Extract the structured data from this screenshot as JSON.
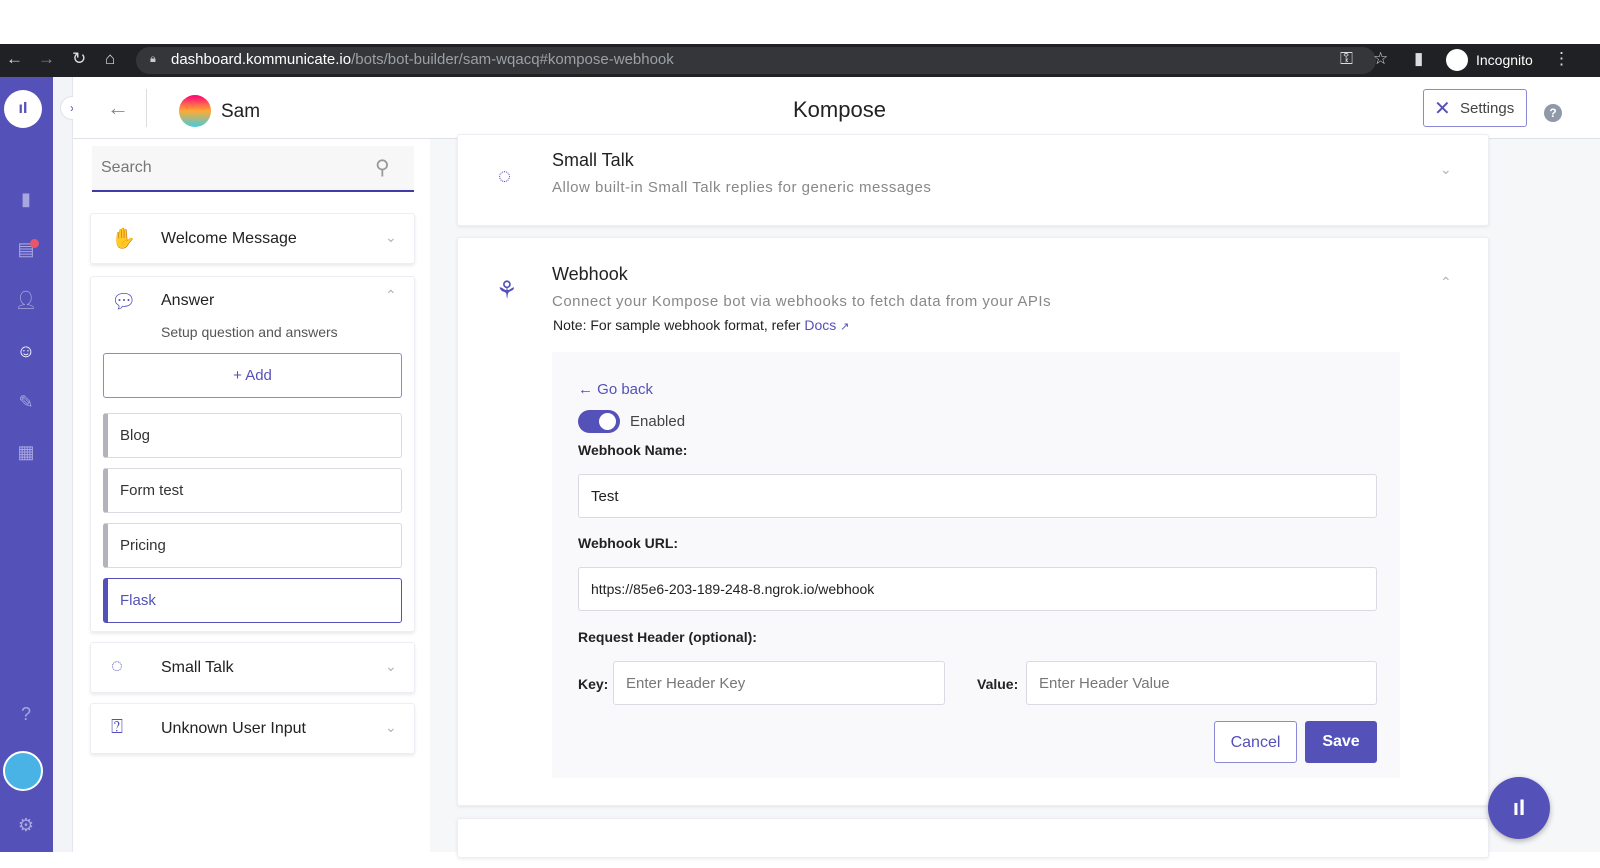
{
  "browser": {
    "url_domain": "dashboard.kommunicate.io",
    "url_path": "/bots/bot-builder/sam-wqacq#kompose-webhook",
    "profile": "Incognito"
  },
  "header": {
    "bot_name": "Sam",
    "title": "Kompose",
    "settings_label": "Settings"
  },
  "sidebar": {
    "search_placeholder": "Search",
    "sections": [
      {
        "label": "Welcome Message"
      },
      {
        "label": "Answer",
        "description": "Setup question and answers",
        "add_label": "+ Add"
      },
      {
        "label": "Small Talk"
      },
      {
        "label": "Unknown User Input"
      }
    ],
    "answers": [
      "Blog",
      "Form test",
      "Pricing",
      "Flask"
    ]
  },
  "small_talk": {
    "title": "Small Talk",
    "description": "Allow built-in Small Talk replies for generic messages"
  },
  "webhook": {
    "title": "Webhook",
    "description": "Connect your Kompose bot via webhooks to fetch data from your APIs",
    "note": "Note: For sample webhook format, refer",
    "docs_link": "Docs",
    "go_back": "← Go back",
    "enabled_label": "Enabled",
    "enabled": true,
    "name_label": "Webhook Name:",
    "name_value": "Test",
    "url_label": "Webhook URL:",
    "url_value": "https://85e6-203-189-248-8.ngrok.io/webhook",
    "header_label": "Request Header (optional):",
    "key_label": "Key:",
    "key_placeholder": "Enter Header Key",
    "value_label": "Value:",
    "value_placeholder": "Enter Header Value",
    "cancel_label": "Cancel",
    "save_label": "Save"
  },
  "colors": {
    "accent": "#5451b8"
  }
}
